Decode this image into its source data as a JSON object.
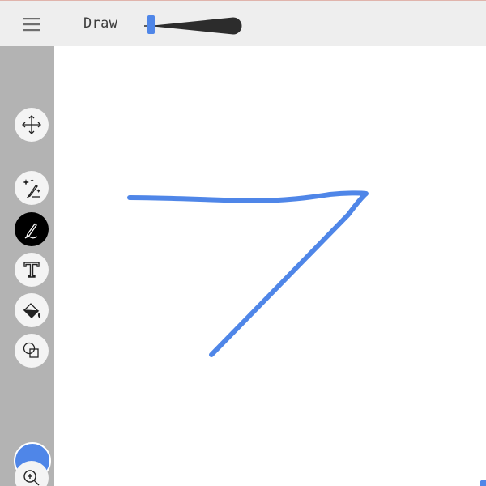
{
  "toolbar": {
    "menu_icon": "hamburger-menu-icon",
    "mode_label": "Draw",
    "brush_size_icon": "brush-size-slider"
  },
  "sidebar": {
    "tools": [
      {
        "name": "move",
        "icon": "move-arrows-icon",
        "active": false
      },
      {
        "name": "magic-pen",
        "icon": "sparkle-pen-icon",
        "active": false
      },
      {
        "name": "pen",
        "icon": "pen-icon",
        "active": true
      },
      {
        "name": "text",
        "icon": "text-icon",
        "active": false
      },
      {
        "name": "fill",
        "icon": "paint-bucket-icon",
        "active": false
      },
      {
        "name": "shapes",
        "icon": "shapes-icon",
        "active": false
      }
    ],
    "zoom_icon": "zoom-in-icon"
  },
  "colors": {
    "stroke": "#4f86e8",
    "sidebar_bg": "#b3b3b3",
    "topbar_bg": "#eeeeee",
    "active_tool_bg": "#000000",
    "slider_handle": "#4f86e8"
  }
}
